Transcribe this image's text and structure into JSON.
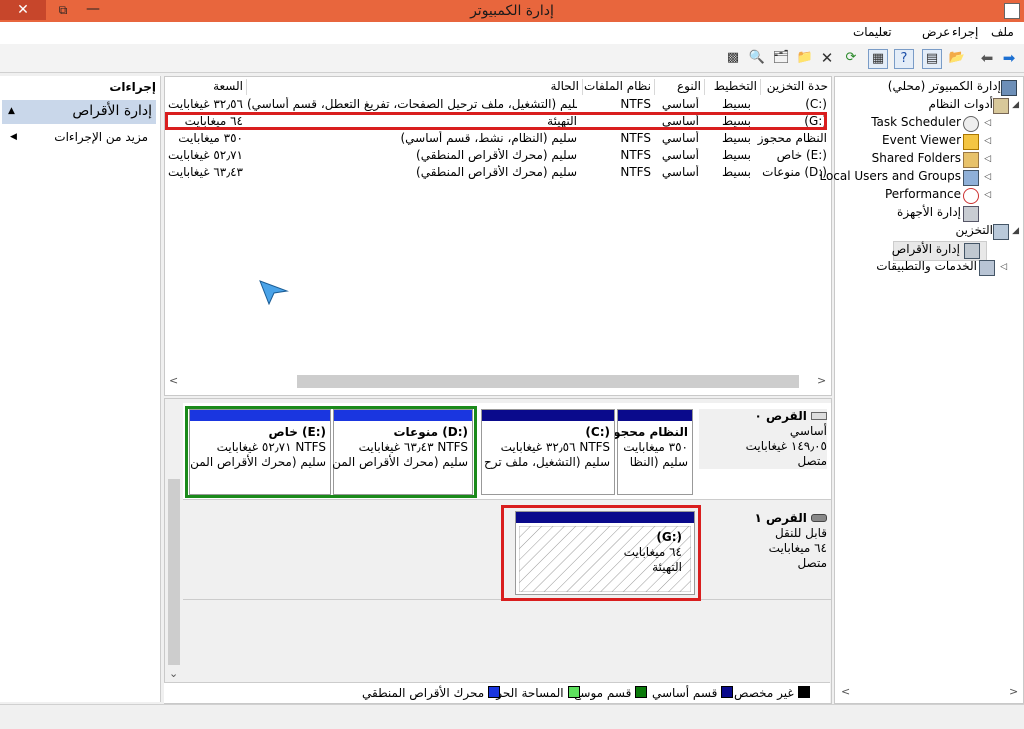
{
  "window": {
    "title": "إدارة الكمبيوتر",
    "close": "✕",
    "maximize": "⧉",
    "minimize": "—"
  },
  "menu": [
    "ملف",
    "إجراء",
    "عرض",
    "تعليمات"
  ],
  "actions": {
    "header": "إجراءات",
    "selected": "إدارة الأقراص",
    "more": "مزيد من الإجراءات"
  },
  "volume_table": {
    "headers": [
      "حدة التخزين",
      "التخطيط",
      "النوع",
      "نظام الملفات",
      "الحالة",
      "السعة"
    ],
    "rows": [
      [
        "(C:)",
        "بسيط",
        "أساسي",
        "NTFS",
        "سليم (التشغيل، ملف ترحيل الصفحات، تفريغ التعطل، قسم أساسي)",
        "٣٢٫٥٦ غيغابايت"
      ],
      [
        "(G:)",
        "بسيط",
        "أساسي",
        "",
        "التهيئة",
        "٦٤ ميغابايت"
      ],
      [
        "النظام محجوز",
        "بسيط",
        "أساسي",
        "NTFS",
        "سليم (النظام، نشط، قسم أساسي)",
        "٣٥٠ ميغابايت"
      ],
      [
        "خاص (E:)",
        "بسيط",
        "أساسي",
        "NTFS",
        "سليم (محرك الأقراص المنطقي)",
        "٥٢٫٧١ غيغابايت"
      ],
      [
        "منوعات (D:)",
        "بسيط",
        "أساسي",
        "NTFS",
        "سليم (محرك الأقراص المنطقي)",
        "٦٣٫٤٣ غيغابايت"
      ]
    ]
  },
  "disks": [
    {
      "name": "القرص ٠",
      "type": "أساسي",
      "size": "١٤٩٫٠٥ غيغابايت",
      "status": "متصل"
    },
    {
      "name": "القرص ١",
      "type": "قابل للنقل",
      "size": "٦٤ ميغابايت",
      "status": "متصل"
    }
  ],
  "partitions": {
    "sysres": {
      "title": "النظام محجو",
      "line1": "٣٥٠ ميغابايت",
      "line2": "سليم (النظا"
    },
    "c": {
      "title": "(C:)",
      "line1": "٣٢٫٥٦ غيغابايت NTFS",
      "line2": "سليم (التشغيل، ملف ترح"
    },
    "d": {
      "title": "منوعات  (D:)",
      "line1": "٦٣٫٤٣ غيغابايت NTFS",
      "line2": "سليم (محرك الأقراص المن"
    },
    "e": {
      "title": "خاص  (E:)",
      "line1": "٥٢٫٧١ غيغابايت NTFS",
      "line2": "سليم (محرك الأقراص المن"
    },
    "g": {
      "title": "(G:)",
      "line1": "٦٤ ميغابايت",
      "line2": "التهيئة"
    }
  },
  "legend": [
    "غير مخصص",
    "قسم أساسي",
    "قسم موسع",
    "المساحة الحرة",
    "محرك الأقراص المنطقي"
  ],
  "legend_colors": [
    "#000000",
    "#0a7a0a",
    "#5ee05e",
    "#1a36e0",
    "#0000c8"
  ],
  "tree": {
    "root": "إدارة الكمبيوتر (محلي)",
    "system_tools": "أدوات النظام",
    "task_scheduler": "Task Scheduler",
    "event_viewer": "Event Viewer",
    "shared_folders": "Shared Folders",
    "local_users": "Local Users and Groups",
    "performance": "Performance",
    "device_manager": "إدارة الأجهزة",
    "storage": "التخزين",
    "disk_management": "إدارة الأقراص",
    "services": "الخدمات والتطبيقات"
  }
}
